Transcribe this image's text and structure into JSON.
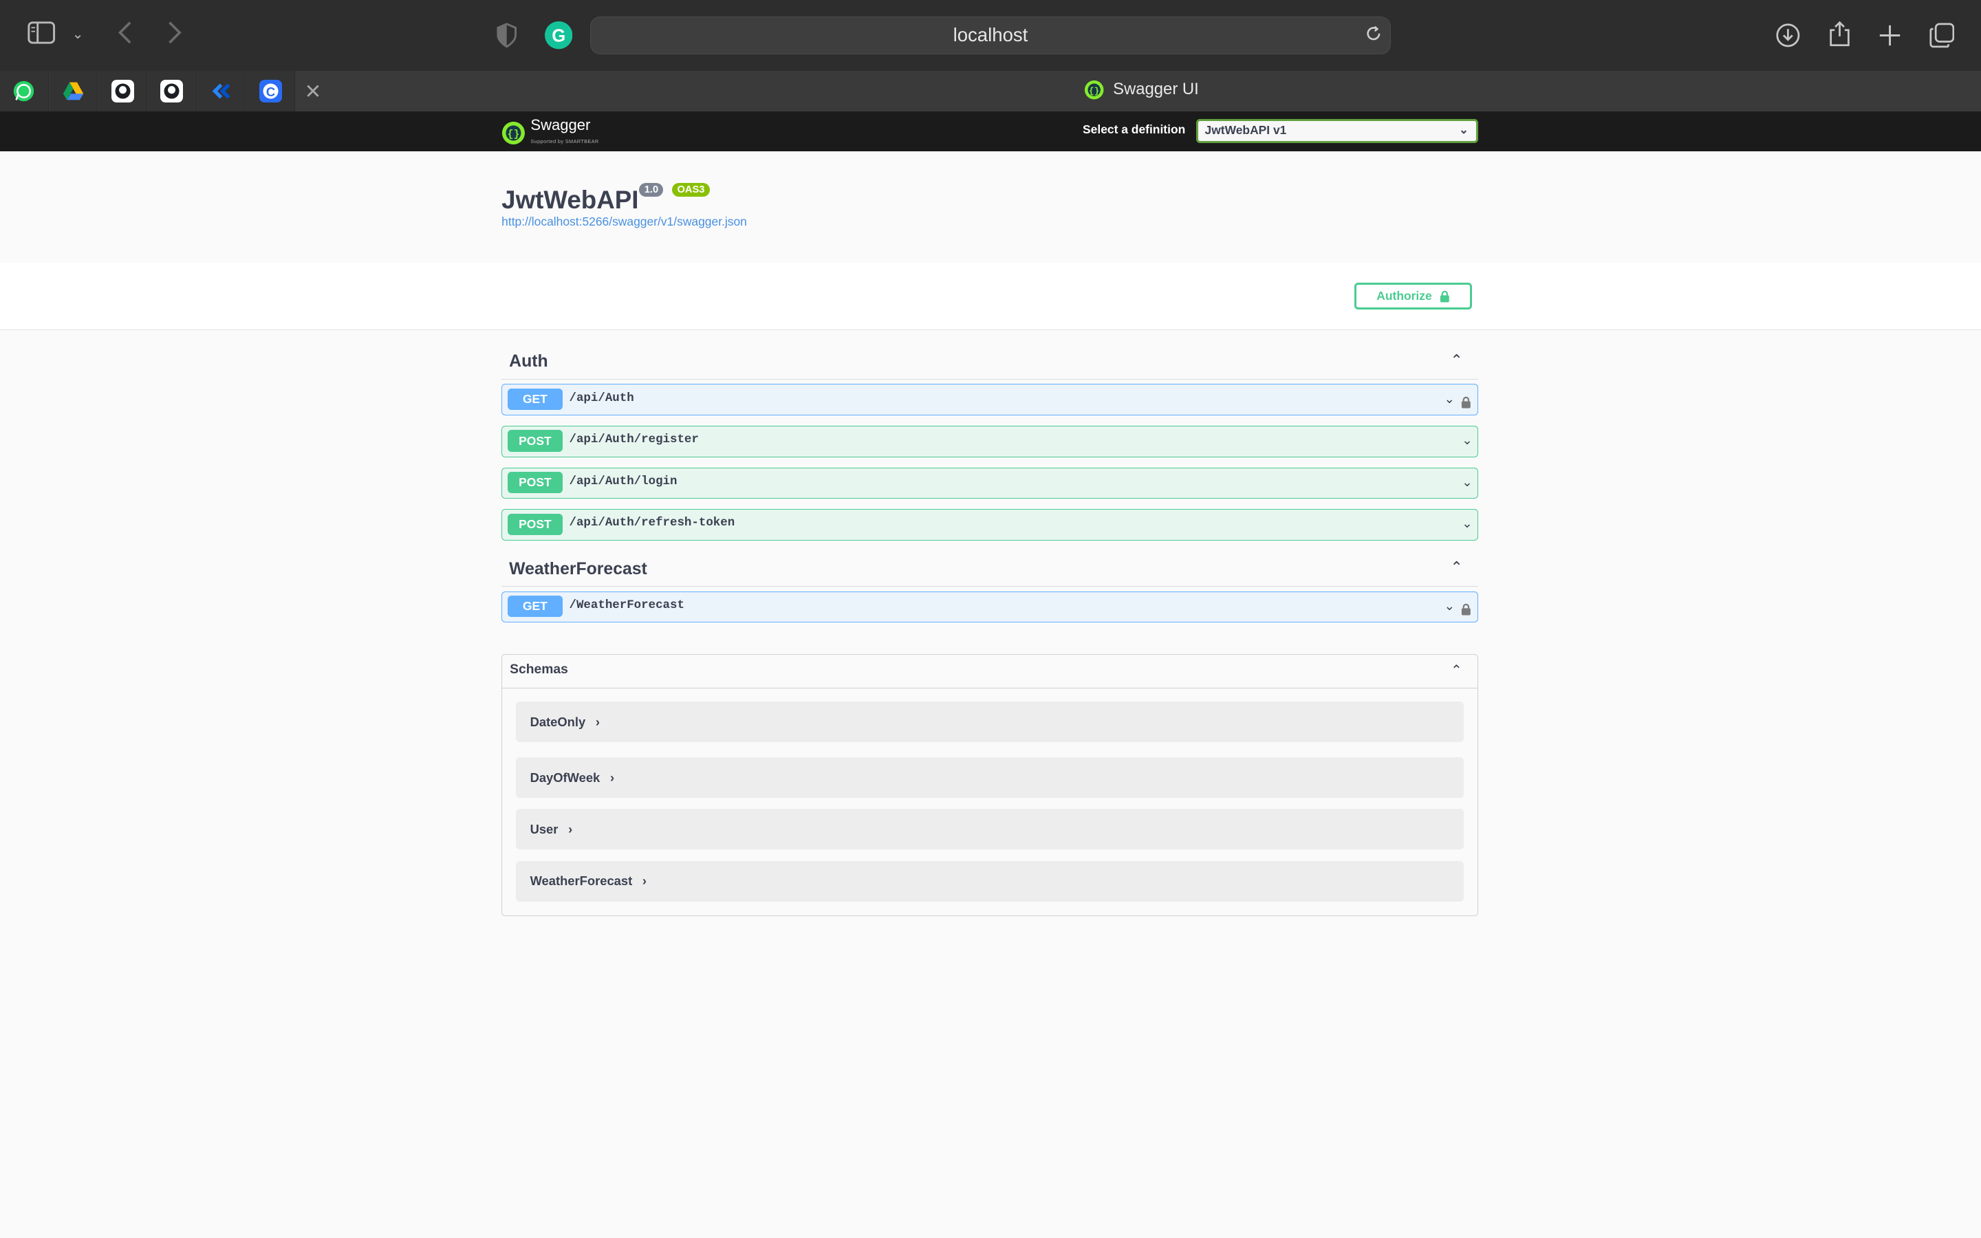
{
  "browser": {
    "url": "localhost",
    "active_tab_title": "Swagger UI",
    "pinned_tabs": [
      "whatsapp-icon",
      "google-drive-icon",
      "github-icon",
      "github-icon",
      "jira-icon",
      "c-app-icon"
    ]
  },
  "swagger": {
    "logo_text": "Swagger",
    "logo_sub": "Supported by SMARTBEAR",
    "definition_label": "Select a definition",
    "definition_value": "JwtWebAPI v1"
  },
  "info": {
    "title": "JwtWebAPI",
    "version": "1.0",
    "oas": "OAS3",
    "spec_url": "http://localhost:5266/swagger/v1/swagger.json"
  },
  "authorize_label": "Authorize",
  "tags": [
    {
      "name": "Auth",
      "operations": [
        {
          "method": "GET",
          "path": "/api/Auth",
          "locked": true
        },
        {
          "method": "POST",
          "path": "/api/Auth/register",
          "locked": false
        },
        {
          "method": "POST",
          "path": "/api/Auth/login",
          "locked": false
        },
        {
          "method": "POST",
          "path": "/api/Auth/refresh-token",
          "locked": false
        }
      ]
    },
    {
      "name": "WeatherForecast",
      "operations": [
        {
          "method": "GET",
          "path": "/WeatherForecast",
          "locked": true
        }
      ]
    }
  ],
  "schemas": {
    "title": "Schemas",
    "models": [
      "DateOnly",
      "DayOfWeek",
      "User",
      "WeatherForecast"
    ]
  },
  "colors": {
    "get": "#61affe",
    "post": "#49cc90",
    "topbar": "#1b1b1b"
  }
}
